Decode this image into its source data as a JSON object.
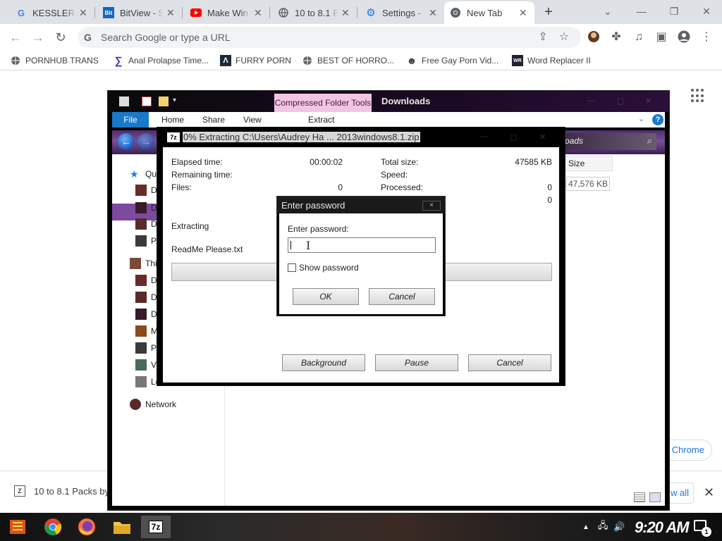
{
  "chrome": {
    "tabs": [
      {
        "title": "KESSLER",
        "favicon": "google-icon"
      },
      {
        "title": "BitView - S",
        "favicon": "bitview-icon"
      },
      {
        "title": "Make Win",
        "favicon": "youtube-icon"
      },
      {
        "title": "10 to 8.1 P",
        "favicon": "globe-icon"
      },
      {
        "title": "Settings -",
        "favicon": "settings-gear-icon"
      },
      {
        "title": "New Tab",
        "favicon": "chrome-icon"
      }
    ],
    "new_tab_symbol": "+",
    "omnibox_placeholder": "Search Google or type a URL",
    "omnibox_g": "G",
    "bookmarks": [
      {
        "label": "PORNHUB TRANS",
        "icon": "globe-icon"
      },
      {
        "label": "Anal Prolapse Time...",
        "icon": "sigma-icon"
      },
      {
        "label": "FURRY PORN",
        "icon": "lambda-icon"
      },
      {
        "label": "BEST OF HORRO...",
        "icon": "globe-icon"
      },
      {
        "label": "Free Gay Porn Vid...",
        "icon": "mask-icon"
      },
      {
        "label": "Word Replacer II",
        "icon": "wr-icon"
      }
    ],
    "chrome_pill": "Chrome",
    "download": {
      "file": "10 to 8.1 Packs by",
      "show_all": "w all"
    }
  },
  "explorer": {
    "title": "Downloads",
    "context_tab": "Compressed Folder Tools",
    "ribbon": [
      "File",
      "Home",
      "Share",
      "View",
      "Extract"
    ],
    "help": "?",
    "search_text": "oads",
    "nav": [
      {
        "label": "Qui",
        "icon": "star-icon"
      },
      {
        "label": "De",
        "icon": "folder-icon"
      },
      {
        "label": "Do",
        "icon": "download-folder-icon"
      },
      {
        "label": "Do",
        "icon": "document-folder-icon"
      },
      {
        "label": "Pi",
        "icon": "picture-folder-icon"
      },
      {
        "label": "Thi",
        "icon": "computer-icon"
      },
      {
        "label": "De",
        "icon": "folder-icon"
      },
      {
        "label": "Do",
        "icon": "folder-icon"
      },
      {
        "label": "Do",
        "icon": "folder-icon"
      },
      {
        "label": "Mu",
        "icon": "music-folder-icon"
      },
      {
        "label": "Pi",
        "icon": "picture-folder-icon"
      },
      {
        "label": "Vi",
        "icon": "video-folder-icon"
      },
      {
        "label": "Lo",
        "icon": "drive-icon"
      },
      {
        "label": "Network",
        "icon": "network-icon"
      }
    ],
    "column_size": "Size",
    "file_size": "47,576 KB"
  },
  "zip": {
    "logo": "7z",
    "title": "0% Extracting C:\\Users\\Audrey Ha ... 2013windows8.1.zip",
    "elapsed_label": "Elapsed time:",
    "elapsed_value": "00:00:02",
    "remaining_label": "Remaining time:",
    "files_label": "Files:",
    "files_value": "0",
    "total_size_label": "Total size:",
    "total_size_value": "47585 KB",
    "speed_label": "Speed:",
    "processed_label": "Processed:",
    "processed_value": "0",
    "extra_value": "0",
    "status": "Extracting",
    "current_file": "ReadMe Please.txt",
    "btn_background": "Background",
    "btn_pause": "Pause",
    "btn_cancel": "Cancel"
  },
  "password": {
    "title": "Enter password",
    "close": "×",
    "label": "Enter password:",
    "value": "",
    "show_label": "Show password",
    "ok": "OK",
    "cancel": "Cancel"
  },
  "taskbar": {
    "apps": [
      "start-icon",
      "chrome-icon",
      "firefox-icon",
      "file-explorer-icon",
      "7zip-icon"
    ],
    "active_app": "7z",
    "clock": "9:20 AM",
    "notif_badge": "1"
  }
}
